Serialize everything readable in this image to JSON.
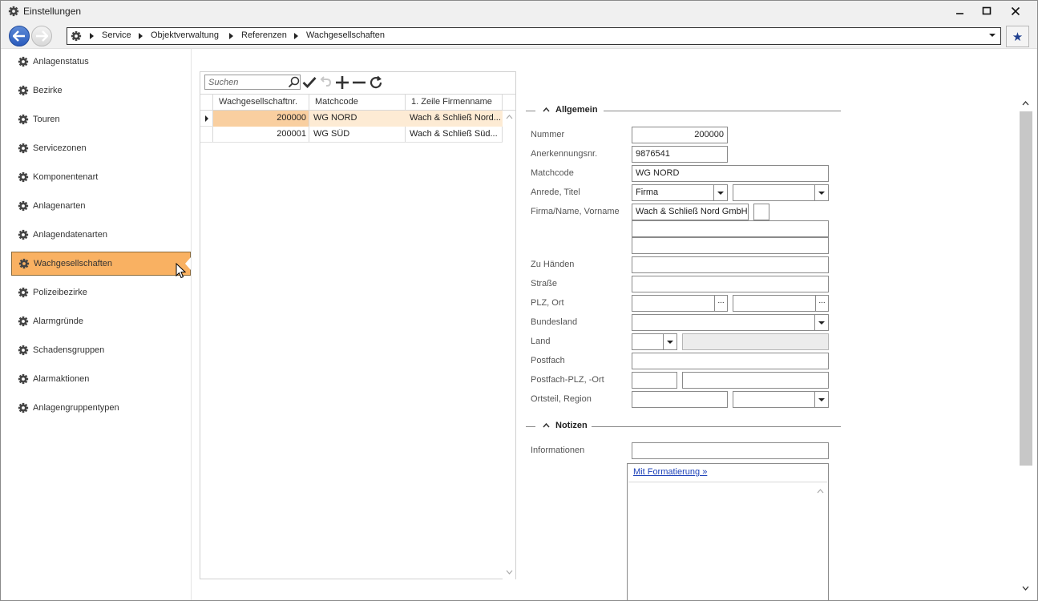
{
  "window": {
    "title": "Einstellungen",
    "title_icon": "gear-icon",
    "controls": [
      "minimize-icon",
      "maximize-icon",
      "close-icon"
    ]
  },
  "nav": {
    "breadcrumbs": [
      "Service",
      "Objektverwaltung",
      "Referenzen",
      "Wachgesellschaften"
    ]
  },
  "sidebar": {
    "items": [
      {
        "label": "Anlagenstatus"
      },
      {
        "label": "Bezirke"
      },
      {
        "label": "Touren"
      },
      {
        "label": "Servicezonen"
      },
      {
        "label": "Komponentenart"
      },
      {
        "label": "Anlagenarten"
      },
      {
        "label": "Anlagendatenarten"
      },
      {
        "label": "Wachgesellschaften",
        "active": true
      },
      {
        "label": "Polizeibezirke"
      },
      {
        "label": "Alarmgründe"
      },
      {
        "label": "Schadensgruppen"
      },
      {
        "label": "Alarmaktionen"
      },
      {
        "label": "Anlagengruppentypen"
      }
    ],
    "active_color": "#f9b162"
  },
  "grid": {
    "search_placeholder": "Suchen",
    "toolbar": [
      "search-icon",
      "save-check-icon",
      "undo-icon",
      "add-icon",
      "remove-icon",
      "refresh-icon"
    ],
    "columns": [
      "Wachgesellschaftnr.",
      "Matchcode",
      "1. Zeile Firmenname"
    ],
    "rows": [
      {
        "nr": "200000",
        "matchcode": "WG NORD",
        "firma": "Wach & Schließ Nord...",
        "selected": true
      },
      {
        "nr": "200001",
        "matchcode": "WG SÜD",
        "firma": "Wach & Schließ Süd..."
      }
    ],
    "selected_row_color": "#fdebd4"
  },
  "form": {
    "section_general": "Allgemein",
    "section_notes": "Notizen",
    "labels": {
      "nummer": "Nummer",
      "anerkennung": "Anerkennungsnr.",
      "matchcode": "Matchcode",
      "anrede": "Anrede, Titel",
      "firma": "Firma/Name, Vorname",
      "zuhaenden": "Zu Händen",
      "strasse": "Straße",
      "plzort": "PLZ, Ort",
      "bundesland": "Bundesland",
      "land": "Land",
      "postfach": "Postfach",
      "postfachplz": "Postfach-PLZ, -Ort",
      "ortsteil": "Ortsteil, Region",
      "informationen": "Informationen"
    },
    "values": {
      "nummer": "200000",
      "anerkennung": "9876541",
      "matchcode": "WG NORD",
      "anrede": "Firma",
      "firma": "Wach & Schließ Nord GmbH"
    },
    "ellipsis": "...",
    "rich_link": "Mit Formatierung »"
  }
}
